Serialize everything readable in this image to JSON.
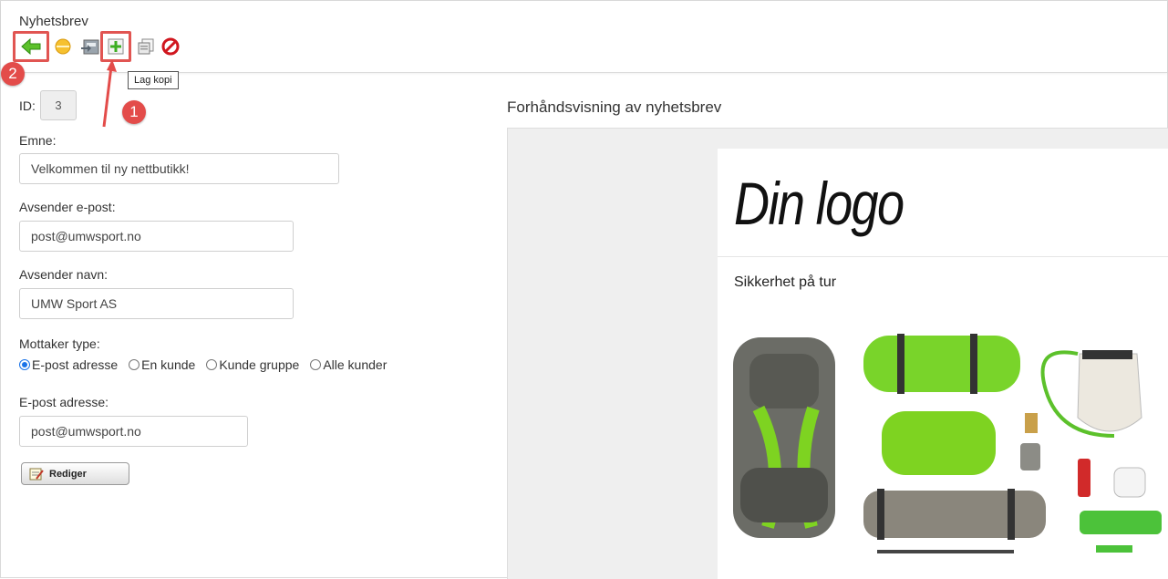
{
  "page": {
    "title": "Nyhetsbrev"
  },
  "toolbar": {
    "tooltip": "Lag kopi",
    "badge_1": "1",
    "badge_2": "2",
    "buttons": [
      "back-icon",
      "sun-icon",
      "export-icon",
      "copy-add-icon",
      "duplicate-icon",
      "delete-icon"
    ]
  },
  "form": {
    "id_label": "ID:",
    "id_value": "3",
    "subject_label": "Emne:",
    "subject_value": "Velkommen til ny nettbutikk!",
    "sender_email_label": "Avsender e-post:",
    "sender_email_value": "post@umwsport.no",
    "sender_name_label": "Avsender navn:",
    "sender_name_value": "UMW Sport AS",
    "recipient_type_label": "Mottaker type:",
    "recipient_options": [
      "E-post adresse",
      "En kunde",
      "Kunde gruppe",
      "Alle kunder"
    ],
    "recipient_selected": "E-post adresse",
    "email_label": "E-post adresse:",
    "email_value": "post@umwsport.no",
    "edit_button": "Rediger"
  },
  "preview": {
    "title": "Forhåndsvisning av nyhetsbrev",
    "logo_text": "Din logo",
    "heading": "Sikkerhet på tur"
  },
  "colors": {
    "highlight": "#e15552",
    "badge": "#e34c4a",
    "accent_green": "#7ed321"
  }
}
